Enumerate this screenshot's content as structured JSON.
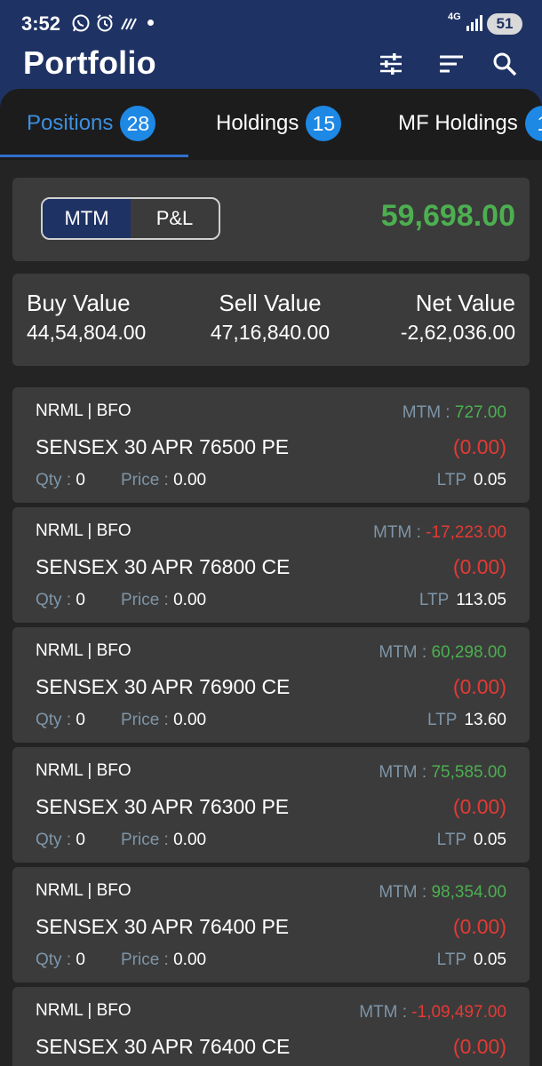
{
  "status_bar": {
    "time": "3:52",
    "network": "4G",
    "battery": "51"
  },
  "app_bar": {
    "title": "Portfolio",
    "icons": [
      "filter-sliders-icon",
      "sort-icon",
      "search-icon"
    ]
  },
  "tabs": [
    {
      "label": "Positions",
      "count": "28",
      "active": true
    },
    {
      "label": "Holdings",
      "count": "15",
      "active": false
    },
    {
      "label": "MF Holdings",
      "count": "1",
      "active": false
    }
  ],
  "summary": {
    "toggle": {
      "options": [
        "MTM",
        "P&L"
      ],
      "selected": "MTM"
    },
    "mtm_total": "59,698.00"
  },
  "values": {
    "buy_label": "Buy Value",
    "buy_value": "44,54,804.00",
    "sell_label": "Sell Value",
    "sell_value": "47,16,840.00",
    "net_label": "Net Value",
    "net_value": "-2,62,036.00"
  },
  "labels": {
    "mtm": "MTM : ",
    "qty": "Qty : ",
    "price": "Price : ",
    "ltp": "LTP"
  },
  "colors": {
    "positive": "#4caf50",
    "negative": "#e53935",
    "accent": "#1e88e5",
    "header": "#1e3264"
  },
  "positions": [
    {
      "product": "NRML | BFO",
      "mtm": "727.00",
      "mtm_sign": "positive",
      "symbol": "SENSEX 30 APR 76500 PE",
      "change": "(0.00)",
      "qty": "0",
      "price": "0.00",
      "ltp": "0.05"
    },
    {
      "product": "NRML | BFO",
      "mtm": "-17,223.00",
      "mtm_sign": "negative",
      "symbol": "SENSEX 30 APR 76800 CE",
      "change": "(0.00)",
      "qty": "0",
      "price": "0.00",
      "ltp": "113.05"
    },
    {
      "product": "NRML | BFO",
      "mtm": "60,298.00",
      "mtm_sign": "positive",
      "symbol": "SENSEX 30 APR 76900 CE",
      "change": "(0.00)",
      "qty": "0",
      "price": "0.00",
      "ltp": "13.60"
    },
    {
      "product": "NRML | BFO",
      "mtm": "75,585.00",
      "mtm_sign": "positive",
      "symbol": "SENSEX 30 APR 76300 PE",
      "change": "(0.00)",
      "qty": "0",
      "price": "0.00",
      "ltp": "0.05"
    },
    {
      "product": "NRML | BFO",
      "mtm": "98,354.00",
      "mtm_sign": "positive",
      "symbol": "SENSEX 30 APR 76400 PE",
      "change": "(0.00)",
      "qty": "0",
      "price": "0.00",
      "ltp": "0.05"
    },
    {
      "product": "NRML | BFO",
      "mtm": "-1,09,497.00",
      "mtm_sign": "negative",
      "symbol": "SENSEX 30 APR 76400 CE",
      "change": "(0.00)",
      "qty": "",
      "price": "",
      "ltp": ""
    }
  ]
}
